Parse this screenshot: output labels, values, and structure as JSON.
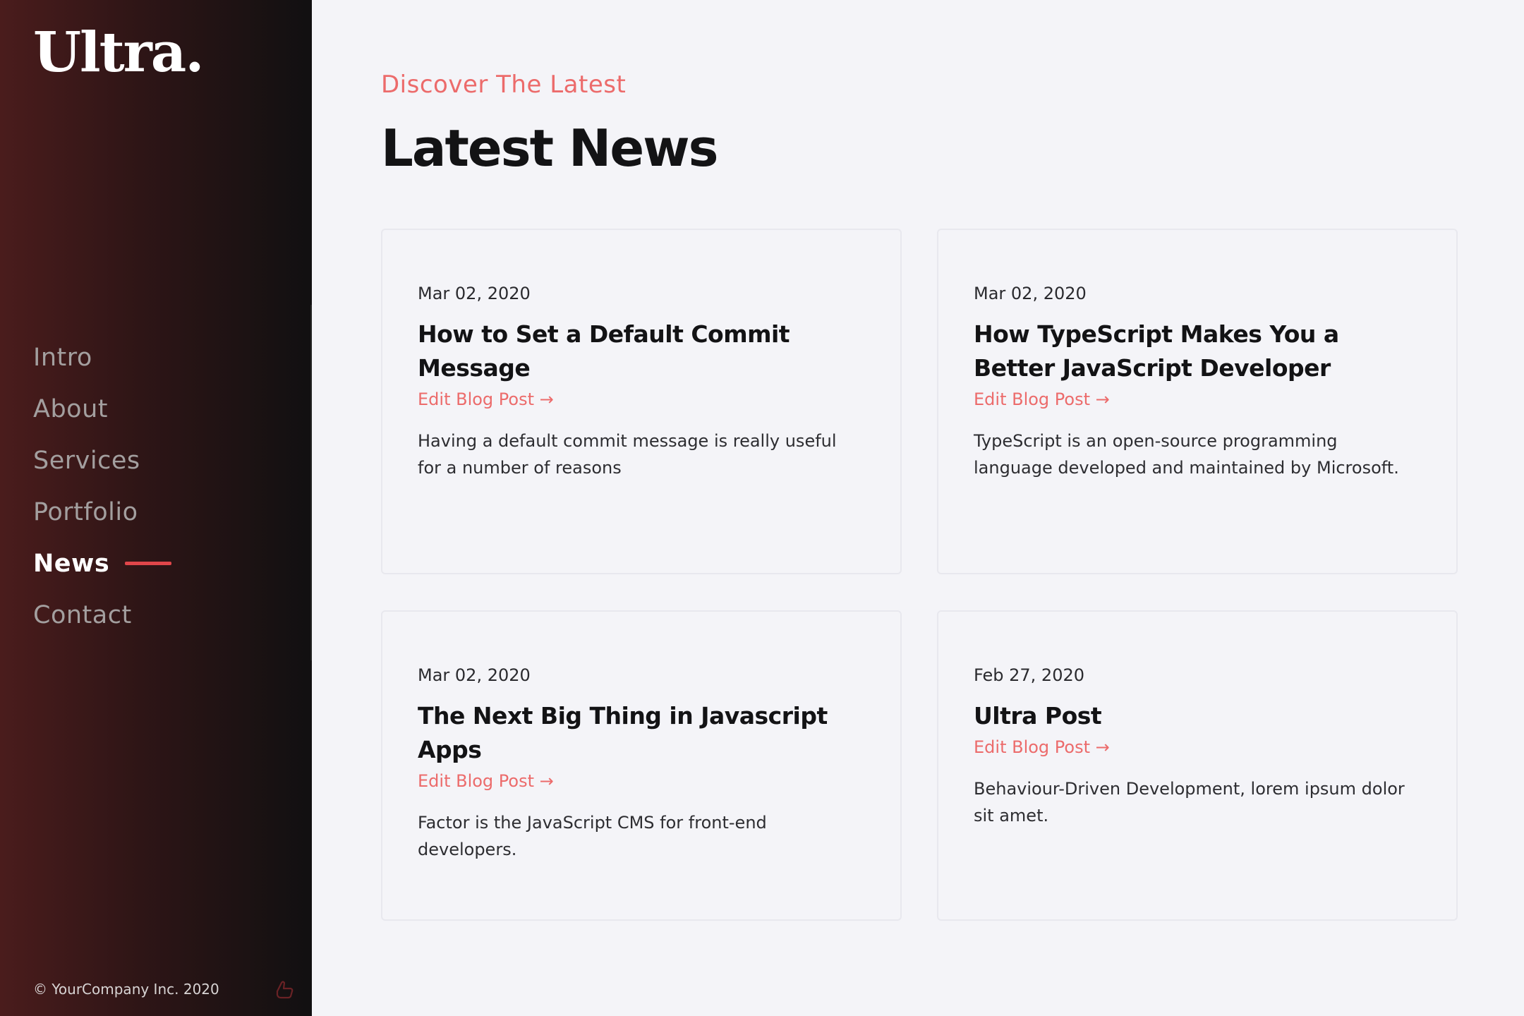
{
  "sidebar": {
    "logo": "Ultra.",
    "nav": [
      {
        "label": "Intro",
        "active": false
      },
      {
        "label": "About",
        "active": false
      },
      {
        "label": "Services",
        "active": false
      },
      {
        "label": "Portfolio",
        "active": false
      },
      {
        "label": "News",
        "active": true
      },
      {
        "label": "Contact",
        "active": false
      }
    ],
    "copyright": "© YourCompany Inc. 2020",
    "corner_icon": "hand-pointer-icon"
  },
  "main": {
    "eyebrow": "Discover The Latest",
    "title": "Latest News",
    "posts": [
      {
        "date": "Mar 02, 2020",
        "title": "How to Set a Default Commit Message",
        "link": "Edit Blog Post →",
        "excerpt": "Having a default commit message is really useful for a number of reasons"
      },
      {
        "date": "Mar 02, 2020",
        "title": "How TypeScript Makes You a Better JavaScript Developer",
        "link": "Edit Blog Post →",
        "excerpt": "TypeScript is an open-source programming language developed and maintained by Microsoft."
      },
      {
        "date": "Mar 02, 2020",
        "title": "The Next Big Thing in Javascript Apps",
        "link": "Edit Blog Post →",
        "excerpt": "Factor is the JavaScript CMS for front-end developers."
      },
      {
        "date": "Feb 27, 2020",
        "title": "Ultra Post",
        "link": "Edit Blog Post →",
        "excerpt": "Behaviour-Driven Development, lorem ipsum dolor sit amet."
      }
    ]
  },
  "colors": {
    "accent": "#ec6b6b",
    "nav_underline": "#e0464a",
    "sidebar_from": "#4a1c1c",
    "sidebar_to": "#111011",
    "background": "#f4f4f8"
  }
}
